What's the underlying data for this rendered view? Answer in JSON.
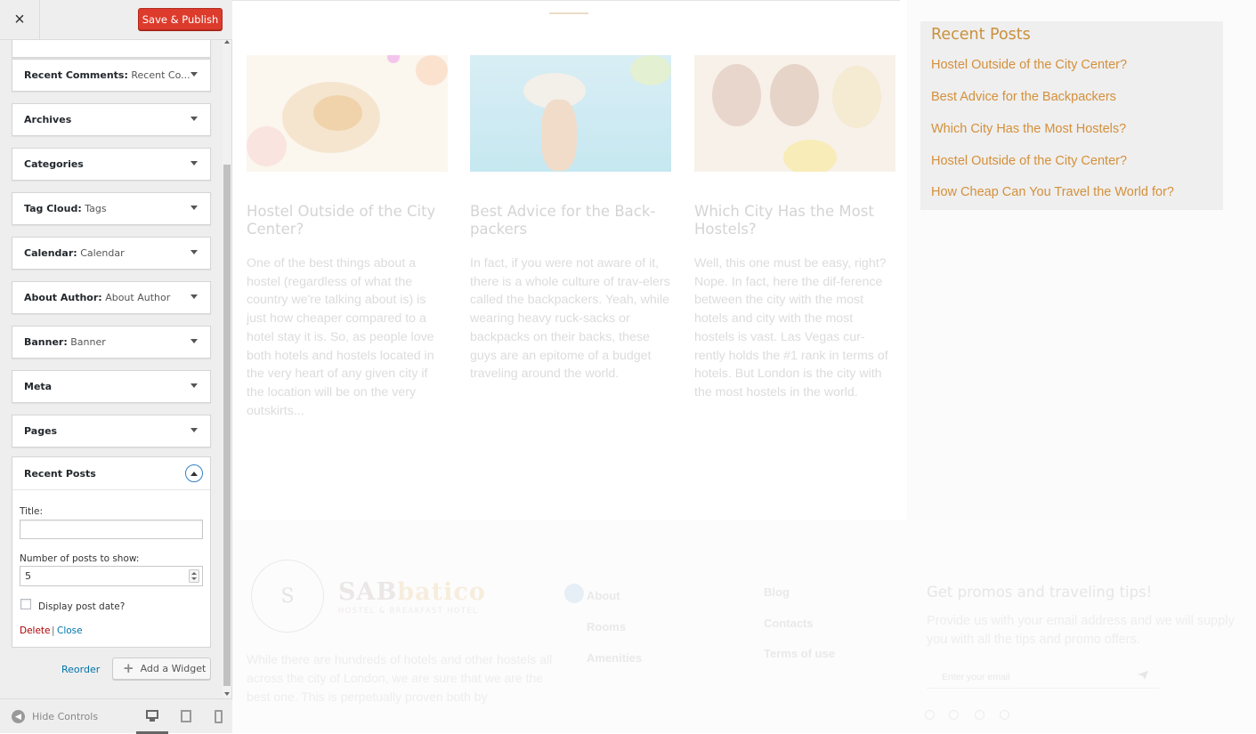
{
  "customizer": {
    "close_label": "×",
    "save_publish_label": "Save & Publish",
    "widgets": [
      {
        "name": "Recent Comments",
        "sub": "Recent Co..."
      },
      {
        "name": "Archives",
        "sub": ""
      },
      {
        "name": "Categories",
        "sub": ""
      },
      {
        "name": "Tag Cloud",
        "sub": "Tags"
      },
      {
        "name": "Calendar",
        "sub": "Calendar"
      },
      {
        "name": "About Author",
        "sub": "About Author"
      },
      {
        "name": "Banner",
        "sub": "Banner"
      },
      {
        "name": "Meta",
        "sub": ""
      },
      {
        "name": "Pages",
        "sub": ""
      }
    ],
    "open_widget": {
      "name": "Recent Posts",
      "title_label": "Title:",
      "title_value": "",
      "num_label": "Number of posts to show:",
      "num_value": "5",
      "date_label": "Display post date?",
      "date_checked": false,
      "delete_label": "Delete",
      "separator": "|",
      "close_label": "Close"
    },
    "reorder_label": "Reorder",
    "add_widget_label": "Add a Widget",
    "hide_controls_label": "Hide Controls"
  },
  "preview": {
    "posts": [
      {
        "title": "Hostel Outside of the City Center?",
        "excerpt": "One of the best things about a hostel (regardless of what the country we're talking about is) is just how cheaper compared to a hotel stay it is. So, as people love both hotels and hostels located in the very heart of any given city if the location will be on the very outskirts..."
      },
      {
        "title": "Best Advice for the Back-packers",
        "excerpt": "In fact, if you were not aware of it, there is a whole culture of trav-elers called the backpackers. Yeah, while wearing heavy ruck-sacks or backpacks on their backs, these guys are an epitome of a budget traveling around the world."
      },
      {
        "title": "Which City Has the Most Hostels?",
        "excerpt": "Well, this one must be easy, right? Nope. In fact, here the dif-ference between the city with the most hotels and city with the most hostels is vast. Las Vegas cur-rently holds the #1 rank in terms of hotels. But London is the city with the most hostels in the world."
      }
    ],
    "recent_posts_widget": {
      "title": "Recent Posts",
      "items": [
        "Hostel Outside of the City Center?",
        "Best Advice for the Backpackers",
        "Which City Has the Most Hostels?",
        "Hostel Outside of the City Center?",
        "How Cheap Can You Travel the World for?"
      ]
    },
    "footer": {
      "logo_letter": "S",
      "logo_name_a": "SAB",
      "logo_name_b": "batico",
      "logo_tagline": "HOSTEL & BREAKFAST HOTEL",
      "about_text": "While there are hundreds of hotels and other hostels all across the city of London, we are sure that we are the best one. This is perpetually proven both by",
      "nav_col1": [
        "About",
        "Rooms",
        "Amenities"
      ],
      "nav_col2": [
        "Blog",
        "Contacts",
        "Terms of use"
      ],
      "promo_title": "Get promos and traveling tips!",
      "promo_text": "Provide us with your email address and we will supply you with all the tips and promo offers.",
      "email_placeholder": "Enter your email"
    }
  },
  "colors": {
    "publish_red": "#dd3b2c",
    "link_blue": "#0073aa",
    "delete_red": "#aa0000",
    "recent_posts_gold": "#d4903a"
  }
}
